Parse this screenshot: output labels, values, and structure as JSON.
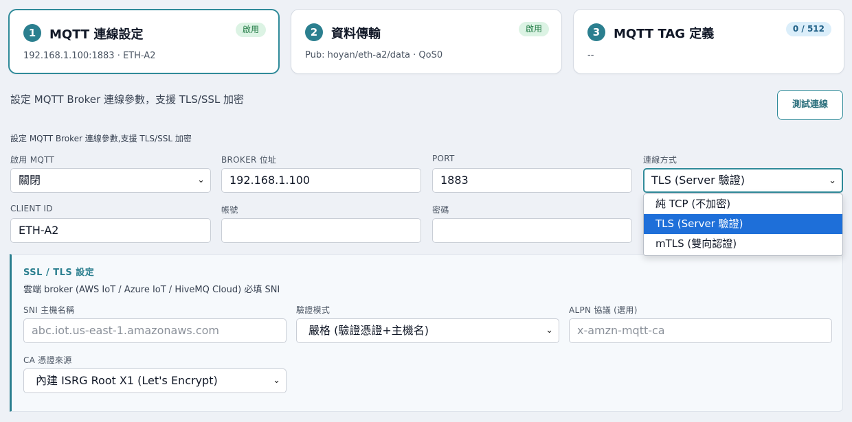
{
  "steps": [
    {
      "num": "1",
      "title": "MQTT 連線設定",
      "sub": "192.168.1.100:1883 · ETH-A2",
      "badge": "啟用"
    },
    {
      "num": "2",
      "title": "資料傳輸",
      "sub": "Pub: hoyan/eth-a2/data · QoS0",
      "badge": "啟用"
    },
    {
      "num": "3",
      "title": "MQTT TAG 定義",
      "sub": "--",
      "badge": "0 / 512"
    }
  ],
  "section": {
    "description": "設定 MQTT Broker 連線參數，支援 TLS/SSL 加密",
    "description_small": "設定 MQTT Broker 連線參數,支援 TLS/SSL 加密",
    "test_button": "測試連線"
  },
  "form": {
    "enable_mqtt": {
      "label": "啟用 MQTT",
      "value": "關閉"
    },
    "broker": {
      "label": "BROKER 位址",
      "value": "192.168.1.100"
    },
    "port": {
      "label": "PORT",
      "value": "1883"
    },
    "conn_mode": {
      "label": "連線方式",
      "value": "TLS (Server 驗證)"
    },
    "client_id": {
      "label": "CLIENT ID",
      "value": "ETH-A2"
    },
    "username": {
      "label": "帳號",
      "value": ""
    },
    "password": {
      "label": "密碼",
      "value": ""
    }
  },
  "dropdown": {
    "options": [
      "純 TCP (不加密)",
      "TLS (Server 驗證)",
      "mTLS (雙向認證)"
    ]
  },
  "ssl": {
    "title": "SSL / TLS 設定",
    "description": "雲端 broker (AWS IoT / Azure IoT / HiveMQ Cloud) 必填 SNI",
    "sni": {
      "label": "SNI 主機名稱",
      "placeholder": "abc.iot.us-east-1.amazonaws.com"
    },
    "verify": {
      "label": "驗證模式",
      "value": "嚴格 (驗證憑證+主機名)"
    },
    "alpn": {
      "label": "ALPN 協議 (選用)",
      "placeholder": "x-amzn-mqtt-ca"
    },
    "ca": {
      "label": "CA 憑證來源",
      "value": "內建 ISRG Root X1 (Let's Encrypt)"
    }
  },
  "icons": {
    "select_arrow": "chevron-down-icon"
  },
  "colors": {
    "accent": "#2b7f8f",
    "badge_green": "#dcf3e4",
    "badge_blue": "#dbeefa",
    "highlight": "#1e6fd9"
  }
}
